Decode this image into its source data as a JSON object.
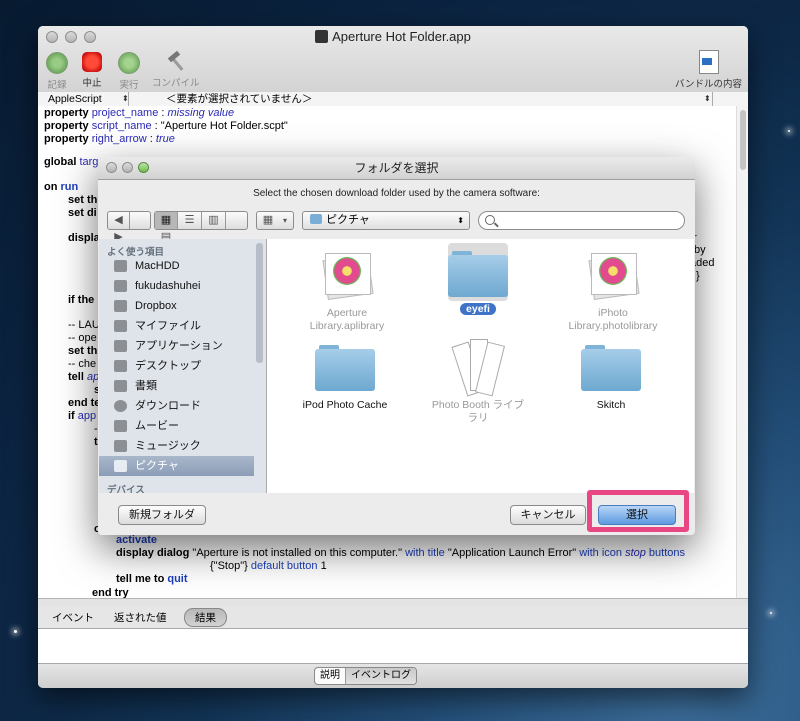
{
  "window": {
    "title": "Aperture Hot Folder.app"
  },
  "toolbar": {
    "record": "記録",
    "stop": "中止",
    "run": "実行",
    "compile": "コンパイル",
    "bundle": "バンドルの内容"
  },
  "navbar": {
    "language": "AppleScript",
    "element": "＜要素が選択されていません＞"
  },
  "code": {
    "l1": [
      "property",
      "project_name",
      " : ",
      "missing value"
    ],
    "l2": [
      "property",
      "script_name",
      " : \"Aperture Hot Folder.scpt\""
    ],
    "l3": [
      "property",
      "right_arrow",
      " : ",
      "true"
    ],
    "l4": [
      "global",
      "targ"
    ],
    "l5": [
      "on",
      "run"
    ],
    "l6": [
      "set th"
    ],
    "l7": [
      "set di"
    ],
    "l8": [
      "displa"
    ],
    "r1": "for",
    "r2": "by",
    "r3": "aded",
    "r4": "}",
    "l9": [
      "if the"
    ],
    "l10": "-- LAU",
    "l11": "-- ope",
    "l12": [
      "set th"
    ],
    "l13": "-- che",
    "l14": [
      "tell",
      "ap"
    ],
    "l15": "s",
    "l16": [
      "end te"
    ],
    "l17": [
      "if",
      "app"
    ],
    "l18": "--",
    "l19": "tr",
    "l20": "o",
    "l21": "activate",
    "l22": [
      "display dialog",
      " \"Aperture is not installed on this computer.\" ",
      "with title",
      " \"Application Launch Error\" ",
      "with icon",
      " ",
      "stop",
      " ",
      "buttons"
    ],
    "l23": [
      "{\"Stop\"} ",
      "default button",
      " 1"
    ],
    "l24": [
      "tell me to",
      " ",
      "quit"
    ],
    "l25": [
      "end try"
    ]
  },
  "bottom_tabs": {
    "events": "イベント",
    "replies": "返された値",
    "result": "結果"
  },
  "footer": {
    "description": "説明",
    "event_log": "イベントログ"
  },
  "dialog": {
    "title": "フォルダを選択",
    "prompt": "Select the chosen download folder used by the camera software:",
    "location": "ピクチャ",
    "sidebar_header": "よく使う項目",
    "sidebar_header2": "デバイス",
    "sidebar": [
      {
        "label": "MacHDD",
        "icon": "harddisk-icon"
      },
      {
        "label": "fukudashuhei",
        "icon": "home-icon"
      },
      {
        "label": "Dropbox",
        "icon": "folder-icon"
      },
      {
        "label": "マイファイル",
        "icon": "allfiles-icon"
      },
      {
        "label": "アプリケーション",
        "icon": "applications-icon"
      },
      {
        "label": "デスクトップ",
        "icon": "desktop-icon"
      },
      {
        "label": "書類",
        "icon": "documents-icon"
      },
      {
        "label": "ダウンロード",
        "icon": "downloads-icon"
      },
      {
        "label": "ムービー",
        "icon": "movies-icon"
      },
      {
        "label": "ミュージック",
        "icon": "music-icon"
      },
      {
        "label": "ピクチャ",
        "icon": "camera-icon"
      }
    ],
    "files": [
      {
        "label1": "Aperture",
        "label2": "Library.aplibrary",
        "icon": "iphoto-library-icon"
      },
      {
        "label1": "eyefi",
        "label2": "",
        "icon": "folder-icon"
      },
      {
        "label1": "iPhoto",
        "label2": "Library.photolibrary",
        "icon": "iphoto-library-icon"
      },
      {
        "label1": "iPod Photo Cache",
        "label2": "",
        "icon": "folder-icon"
      },
      {
        "label1": "Photo Booth ライブ",
        "label2": "ラリ",
        "icon": "photobooth-icon"
      },
      {
        "label1": "Skitch",
        "label2": "",
        "icon": "folder-icon"
      }
    ],
    "new_folder": "新規フォルダ",
    "cancel": "キャンセル",
    "choose": "選択"
  },
  "colors": {
    "highlight": "#e94784",
    "accent": "#5d9ae0",
    "keyword_blue": "#2a2ab5"
  }
}
